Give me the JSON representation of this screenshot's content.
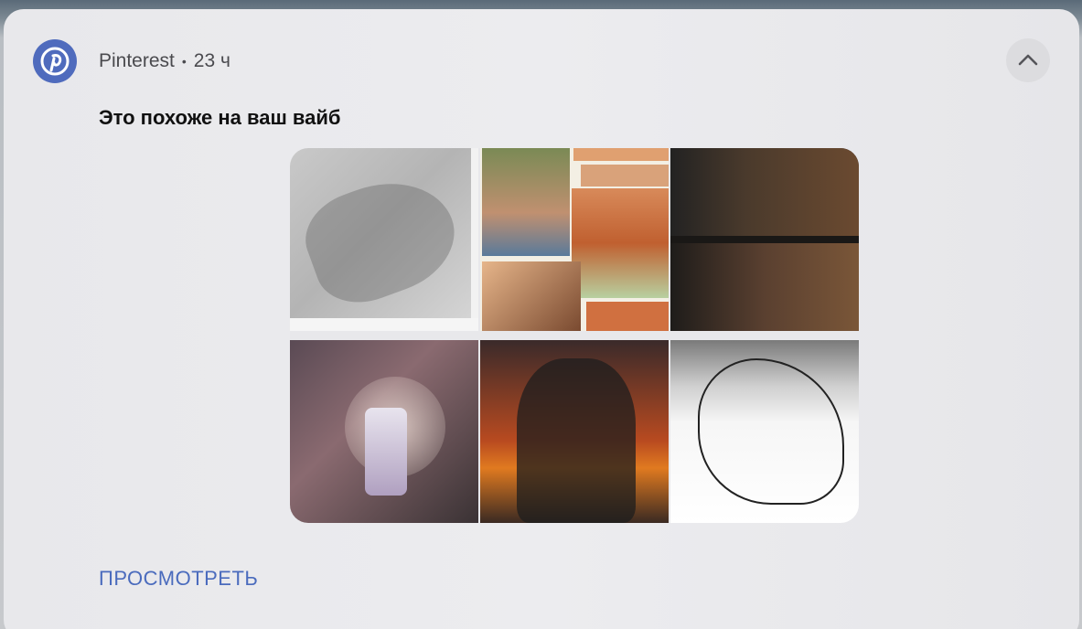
{
  "notification": {
    "app_name": "Pinterest",
    "separator": "•",
    "time": "23 ч",
    "title": "Это похоже на ваш вайб",
    "action_label": "ПРОСМОТРЕТЬ",
    "icons": {
      "app": "pinterest-logo-icon",
      "collapse": "chevron-up-icon"
    },
    "colors": {
      "accent": "#4f6bbd",
      "action": "#4a6bbd"
    }
  }
}
